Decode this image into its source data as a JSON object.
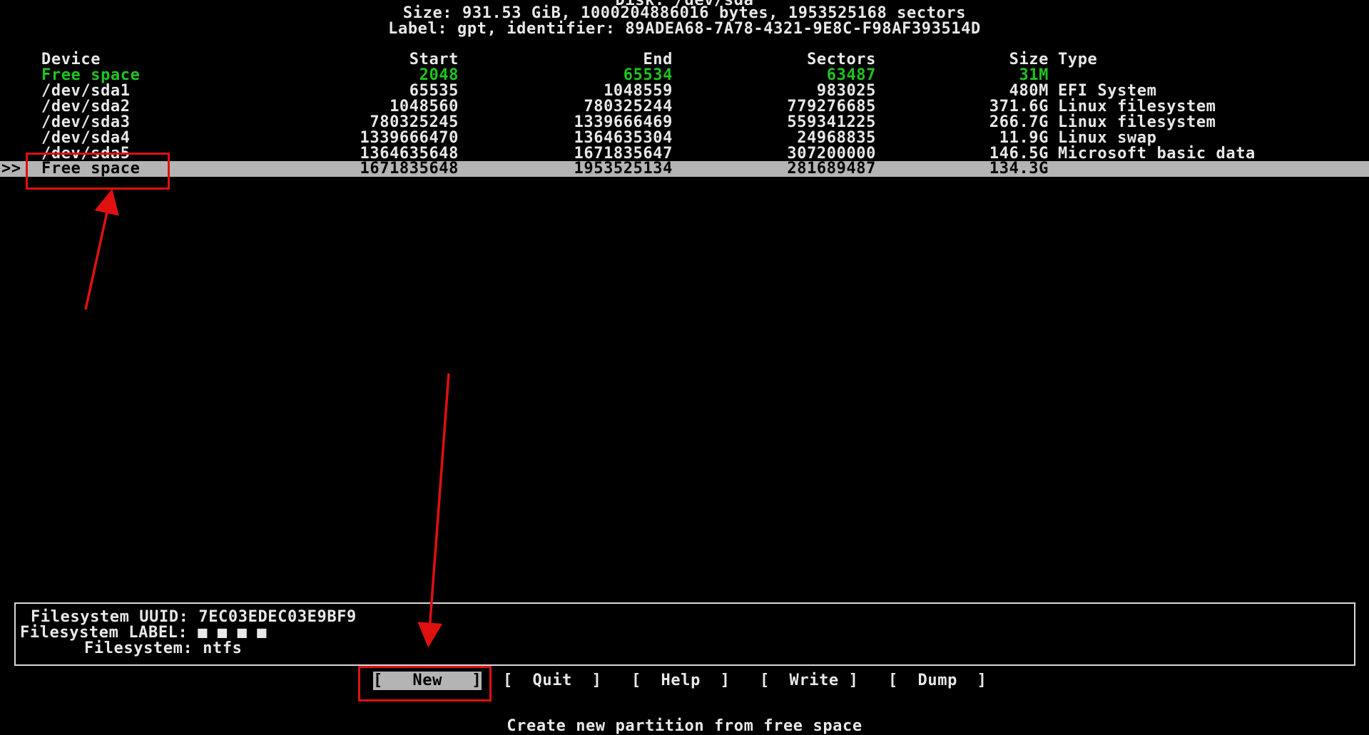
{
  "header": {
    "disk_line": "Disk: /dev/sda",
    "size_line": "Size: 931.53 GiB, 1000204886016 bytes, 1953525168 sectors",
    "label_line": "Label: gpt, identifier: 89ADEA68-7A78-4321-9E8C-F98AF393514D"
  },
  "table": {
    "columns": [
      "Device",
      "Start",
      "End",
      "Sectors",
      "Size",
      "Type"
    ],
    "rows": [
      {
        "pointer": "",
        "device": "Free space",
        "start": "2048",
        "end": "65534",
        "sectors": "63487",
        "size": "31M",
        "type": "",
        "style": "green"
      },
      {
        "pointer": "",
        "device": "/dev/sda1",
        "start": "65535",
        "end": "1048559",
        "sectors": "983025",
        "size": "480M",
        "type": "EFI System",
        "style": "normal"
      },
      {
        "pointer": "",
        "device": "/dev/sda2",
        "start": "1048560",
        "end": "780325244",
        "sectors": "779276685",
        "size": "371.6G",
        "type": "Linux filesystem",
        "style": "normal"
      },
      {
        "pointer": "",
        "device": "/dev/sda3",
        "start": "780325245",
        "end": "1339666469",
        "sectors": "559341225",
        "size": "266.7G",
        "type": "Linux filesystem",
        "style": "normal"
      },
      {
        "pointer": "",
        "device": "/dev/sda4",
        "start": "1339666470",
        "end": "1364635304",
        "sectors": "24968835",
        "size": "11.9G",
        "type": "Linux swap",
        "style": "normal"
      },
      {
        "pointer": "",
        "device": "/dev/sda5",
        "start": "1364635648",
        "end": "1671835647",
        "sectors": "307200000",
        "size": "146.5G",
        "type": "Microsoft basic data",
        "style": "normal"
      },
      {
        "pointer": ">>",
        "device": "Free space",
        "start": "1671835648",
        "end": "1953525134",
        "sectors": "281689487",
        "size": "134.3G",
        "type": "",
        "style": "selected"
      }
    ]
  },
  "info": {
    "uuid_line": "Filesystem UUID: 7EC03EDEC03E9BF9",
    "label_line": "Filesystem LABEL: ■ ■ ■ ■",
    "fs_line": "Filesystem: ntfs"
  },
  "menu": [
    {
      "key": "new",
      "label": "[   New   ]",
      "selected": true
    },
    {
      "key": "quit",
      "label": "[  Quit  ]",
      "selected": false
    },
    {
      "key": "help",
      "label": "[  Help  ]",
      "selected": false
    },
    {
      "key": "write",
      "label": "[  Write ]",
      "selected": false
    },
    {
      "key": "dump",
      "label": "[  Dump  ]",
      "selected": false
    }
  ],
  "status_hint": "Create new partition from free space",
  "colors": {
    "background": "#000000",
    "text": "#e8e8e8",
    "free_space_green": "#1fc41f",
    "selection_bg": "#b4b4b4",
    "annotation_red": "#e01010"
  }
}
